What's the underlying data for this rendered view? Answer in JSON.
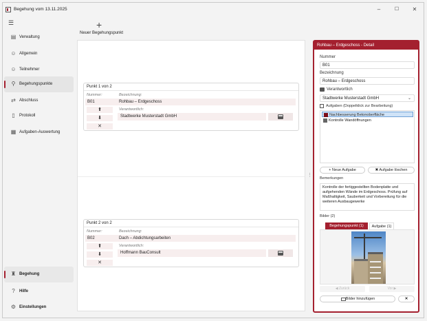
{
  "window": {
    "title": "Begehung vom 13.11.2025",
    "minimize": "–",
    "maximize": "☐",
    "close": "✕"
  },
  "sidebar": {
    "menu_icon": "hamburger-icon",
    "items": [
      {
        "label": "Verwaltung",
        "icon": "clipboard-icon"
      },
      {
        "label": "Allgemein",
        "icon": "people-icon"
      },
      {
        "label": "Teilnehmer",
        "icon": "people-icon"
      },
      {
        "label": "Begehungspunkte",
        "icon": "pin-icon",
        "active": true
      },
      {
        "label": "Abschluss",
        "icon": "shuffle-icon"
      },
      {
        "label": "Protokoll",
        "icon": "document-icon"
      },
      {
        "label": "Aufgaben-Auswertung",
        "icon": "list-icon"
      }
    ],
    "bottom": [
      {
        "label": "Begehung",
        "icon": "walk-icon"
      },
      {
        "label": "Hilfe",
        "icon": "help-icon"
      },
      {
        "label": "Einstellungen",
        "icon": "gear-icon"
      }
    ]
  },
  "toolbar": {
    "add_label": "Neuer Begehungspunkt",
    "add_icon": "+"
  },
  "points": [
    {
      "header": "Punkt 1 von 2",
      "nummer_label": "Nummer:",
      "nummer": "B01",
      "bezeichnung_label": "Bezeichnung:",
      "bezeichnung": "Rohbau – Erdgeschoss",
      "verantwortlich_label": "Verantwortlich:",
      "verantwortlich": "Stadtwerke Musterstadt GmbH",
      "up": "⬆",
      "down": "⬇",
      "remove": "✕"
    },
    {
      "header": "Punkt 2 von 2",
      "nummer_label": "Nummer:",
      "nummer": "B02",
      "bezeichnung_label": "Bezeichnung:",
      "bezeichnung": "Dach – Abdichtungsarbeiten",
      "verantwortlich_label": "Verantwortlich:",
      "verantwortlich": "Hoffmann BauConsult",
      "up": "⬆",
      "down": "⬇",
      "remove": "✕"
    }
  ],
  "detail": {
    "header": "Rohbau – Erdgeschoss - Detail",
    "nummer_label": "Nummer",
    "nummer": "B01",
    "bezeichnung_label": "Bezeichnung",
    "bezeichnung": "Rohbau – Erdgeschoss",
    "verantwortlich_label": "Verantwortlich",
    "verantwortlich": "Stadtwerke Musterstadt GmbH",
    "aufgaben_label": "Aufgaben (Doppelklick zur Bearbeitung)",
    "tasks": [
      {
        "label": "Nachbesserung Betonoberfläche",
        "color": "#7a0c18",
        "selected": true
      },
      {
        "label": "Kontrolle Wandöffnungen",
        "color": "#666666",
        "selected": false
      }
    ],
    "neue_aufgabe": "+ Neue Aufgabe",
    "aufgabe_loeschen": "✖ Aufgabe löschen",
    "bemerkungen_label": "Bemerkungen",
    "bemerkungen": "Kontrolle der fertiggestellten Bodenplatte und aufgehenden Wände im Erdgeschoss. Prüfung auf Maßhaltigkeit, Sauberkeit und Vorbereitung für die weiteren Ausbaugewerke",
    "bilder_label": "Bilder (2)",
    "tab_begehungspunkt": "Begehungspunkt (1)",
    "tab_aufgabe": "Aufgabe (1)",
    "zurueck": "◀ Zurück",
    "vor": "Vor ▶",
    "bilder_hinzufuegen": "Bilder hinzufügen",
    "remove_image": "✕"
  },
  "colors": {
    "accent": "#a4202f",
    "selection": "#cfe3f7"
  }
}
